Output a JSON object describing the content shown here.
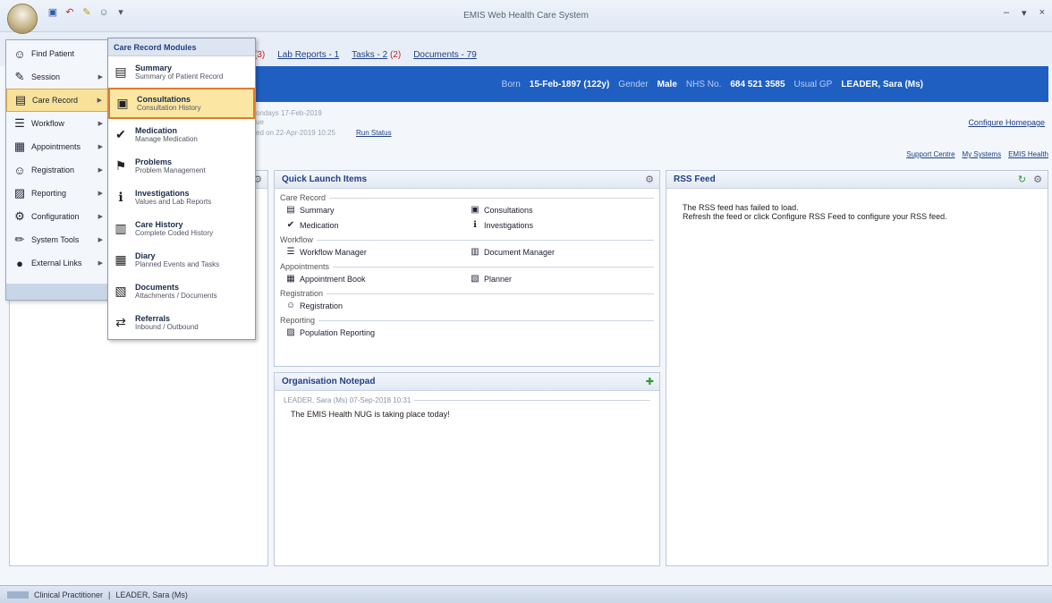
{
  "app": {
    "window_title": "EMIS Web Health Care System",
    "controls": [
      "–",
      "▾",
      "×"
    ]
  },
  "colors": {
    "banner": "#1f5fc2",
    "highlight": "#fbe7a3",
    "highlight_border": "#e07b2d",
    "alert_dot": "#d71a1a"
  },
  "tabs": {
    "partial_count": "(3)",
    "lab_reports": "Lab Reports - 1",
    "tasks": "Tasks - 2",
    "tasks_count": "(2)",
    "documents": "Documents - 79"
  },
  "banner": {
    "born_label": "Born",
    "born_value": "15-Feb-1897 (122y)",
    "gender_label": "Gender",
    "gender_value": "Male",
    "nhs_label": "NHS No.",
    "nhs_value": "684 521 3585",
    "gp_label": "Usual GP",
    "gp_value": "LEADER, Sara (Ms)"
  },
  "info": {
    "line1": "ondays 17-Feb-2019",
    "line2": "ue",
    "line3": "ed on 22-Apr-2019 10:25",
    "run_status": "Run Status",
    "configure_homepage": "Configure Homepage",
    "links": [
      "Support Centre",
      "My Systems",
      "EMIS Health"
    ]
  },
  "quick_launch": {
    "title": "Quick Launch Items",
    "groups": [
      {
        "title": "Care Record",
        "items": [
          {
            "label": "Summary",
            "icon": "summary-icon",
            "glyph": "▤"
          },
          {
            "label": "Consultations",
            "icon": "consultations-icon",
            "glyph": "▣"
          },
          {
            "label": "Medication",
            "icon": "medication-icon",
            "glyph": "✔"
          },
          {
            "label": "Investigations",
            "icon": "investigations-icon",
            "glyph": "ℹ"
          }
        ]
      },
      {
        "title": "Workflow",
        "items": [
          {
            "label": "Workflow Manager",
            "icon": "workflow-icon",
            "glyph": "☰"
          },
          {
            "label": "Document Manager",
            "icon": "document-manager-icon",
            "glyph": "▥"
          }
        ]
      },
      {
        "title": "Appointments",
        "items": [
          {
            "label": "Appointment Book",
            "icon": "appointment-book-icon",
            "glyph": "▦"
          },
          {
            "label": "Planner",
            "icon": "planner-icon",
            "glyph": "▧"
          }
        ]
      },
      {
        "title": "Registration",
        "items": [
          {
            "label": "Registration",
            "icon": "registration-icon",
            "glyph": "☺"
          }
        ]
      },
      {
        "title": "Reporting",
        "items": [
          {
            "label": "Population Reporting",
            "icon": "reporting-icon",
            "glyph": "▨"
          }
        ]
      }
    ]
  },
  "notepad": {
    "title": "Organisation Notepad",
    "author": "LEADER, Sara (Ms) 07-Sep-2018 10:31",
    "text": "The EMIS Health NUG is taking place today!"
  },
  "rss": {
    "title": "RSS Feed",
    "line1": "The RSS feed has failed to load.",
    "line2": "Refresh the feed or click Configure RSS Feed to configure your RSS feed."
  },
  "app_menu": {
    "items": [
      {
        "label": "Find Patient",
        "icon": "find-patient-icon",
        "glyph": "☺",
        "arrow": ""
      },
      {
        "label": "Session",
        "icon": "session-icon",
        "glyph": "✎",
        "arrow": "▶"
      },
      {
        "label": "Care Record",
        "icon": "care-record-icon",
        "glyph": "▤",
        "arrow": "▶"
      },
      {
        "label": "Workflow",
        "icon": "workflow-icon",
        "glyph": "☰",
        "arrow": "▶"
      },
      {
        "label": "Appointments",
        "icon": "appointments-icon",
        "glyph": "▦",
        "arrow": "▶"
      },
      {
        "label": "Registration",
        "icon": "registration-icon",
        "glyph": "☺",
        "arrow": "▶"
      },
      {
        "label": "Reporting",
        "icon": "reporting-icon",
        "glyph": "▨",
        "arrow": "▶"
      },
      {
        "label": "Configuration",
        "icon": "configuration-icon",
        "glyph": "⚙",
        "arrow": "▶"
      },
      {
        "label": "System Tools",
        "icon": "system-tools-icon",
        "glyph": "✏",
        "arrow": "▶"
      },
      {
        "label": "External Links",
        "icon": "external-links-icon",
        "glyph": "●",
        "arrow": "▶"
      }
    ]
  },
  "submenu": {
    "title": "Care Record Modules",
    "items": [
      {
        "title": "Summary",
        "desc": "Summary of Patient Record",
        "icon": "summary-icon",
        "glyph": "▤"
      },
      {
        "title": "Consultations",
        "desc": "Consultation History",
        "icon": "consultations-icon",
        "glyph": "▣"
      },
      {
        "title": "Medication",
        "desc": "Manage Medication",
        "icon": "medication-icon",
        "glyph": "✔"
      },
      {
        "title": "Problems",
        "desc": "Problem Management",
        "icon": "problems-icon",
        "glyph": "⚑"
      },
      {
        "title": "Investigations",
        "desc": "Values and Lab Reports",
        "icon": "investigations-icon",
        "glyph": "ℹ"
      },
      {
        "title": "Care History",
        "desc": "Complete Coded History",
        "icon": "care-history-icon",
        "glyph": "▥"
      },
      {
        "title": "Diary",
        "desc": "Planned Events and Tasks",
        "icon": "diary-icon",
        "glyph": "▦"
      },
      {
        "title": "Documents",
        "desc": "Attachments / Documents",
        "icon": "documents-icon",
        "glyph": "▧"
      },
      {
        "title": "Referrals",
        "desc": "Inbound / Outbound",
        "icon": "referrals-icon",
        "glyph": "⇄"
      }
    ]
  },
  "status_bar": {
    "role": "Clinical Practitioner",
    "sep": "|",
    "user": "LEADER, Sara (Ms)"
  }
}
